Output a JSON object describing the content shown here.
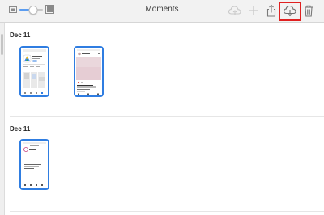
{
  "window": {
    "title": "Moments"
  },
  "toolbar": {
    "zoom_level": 0.6,
    "buttons": [
      {
        "name": "icloud-upload",
        "enabled": false
      },
      {
        "name": "add",
        "enabled": false
      },
      {
        "name": "share",
        "enabled": true
      },
      {
        "name": "download",
        "enabled": true,
        "highlighted": true
      },
      {
        "name": "delete",
        "enabled": true
      }
    ]
  },
  "colors": {
    "accent": "#2f7de1",
    "highlight": "#e02020"
  },
  "sections": [
    {
      "date": "Dec 11"
    },
    {
      "date": "Dec 11"
    }
  ]
}
